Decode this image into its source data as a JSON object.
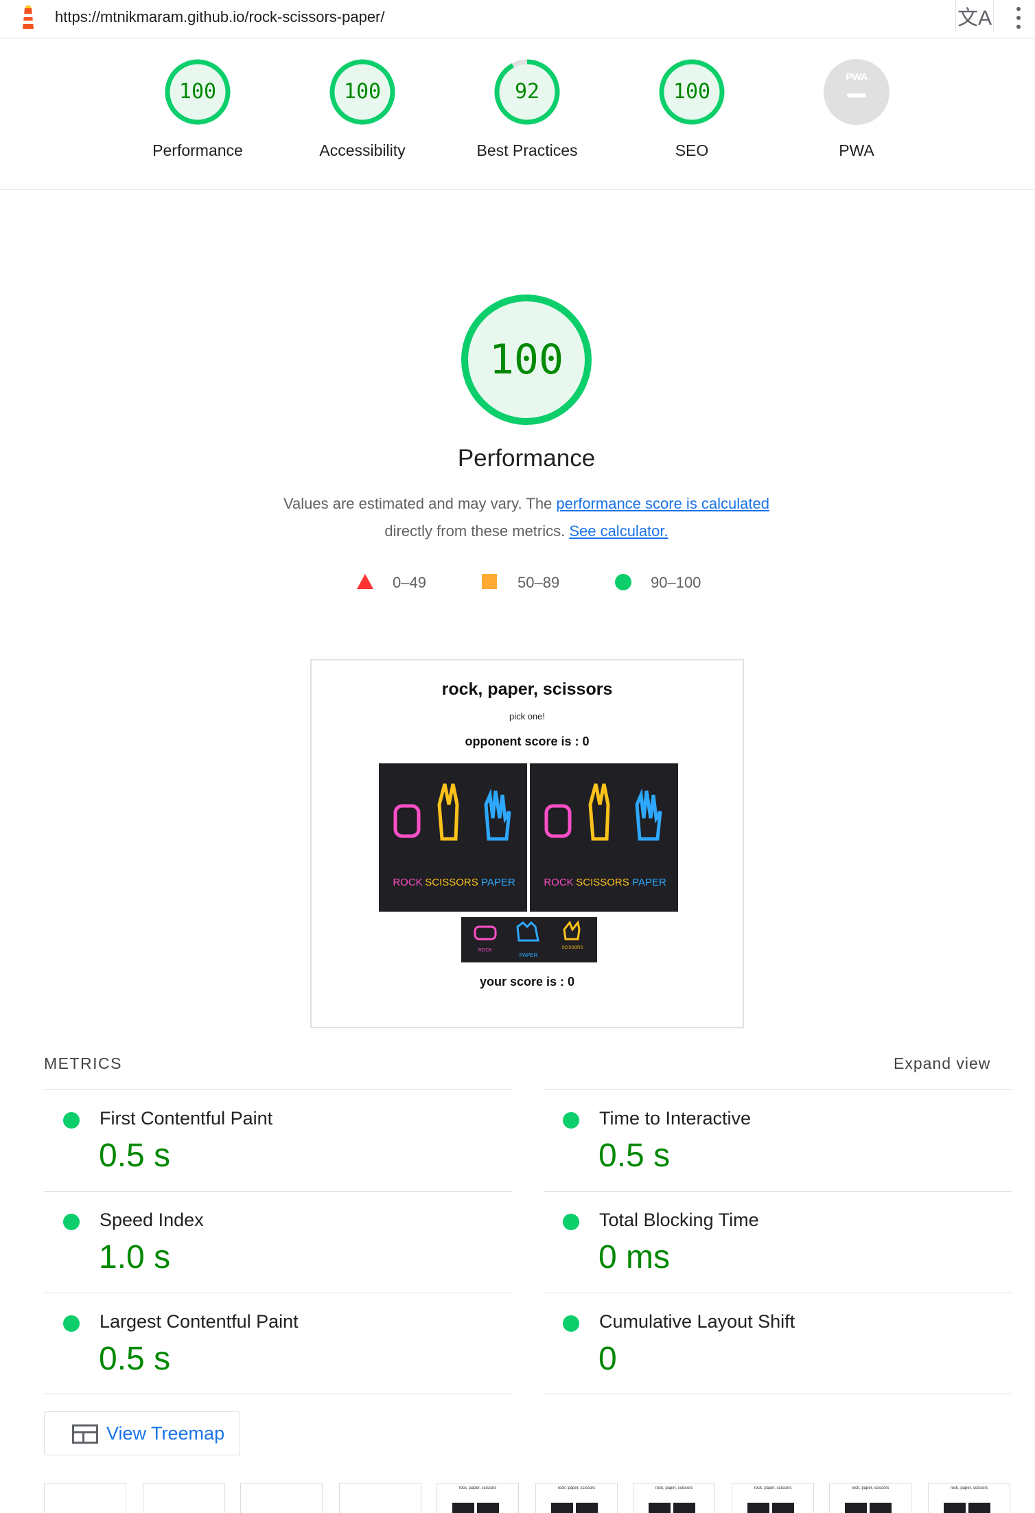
{
  "browser": {
    "url": "https://mtnikmaram.github.io/rock-scissors-paper/"
  },
  "summary": [
    {
      "score": "100",
      "label": "Performance"
    },
    {
      "score": "100",
      "label": "Accessibility"
    },
    {
      "score": "92",
      "label": "Best Practices"
    },
    {
      "score": "100",
      "label": "SEO"
    },
    {
      "score": "",
      "label": "PWA",
      "badge": "PWA"
    }
  ],
  "performance": {
    "score": "100",
    "title": "Performance",
    "desc_prefix": "Values are estimated and may vary. The ",
    "desc_link1": "performance score is calculated",
    "desc_middle": "directly from these metrics. ",
    "desc_link2": "See calculator."
  },
  "legend": [
    {
      "range": "0–49",
      "color": "#ff3333",
      "shape": "triangle"
    },
    {
      "range": "50–89",
      "color": "#ffaa33",
      "shape": "square"
    },
    {
      "range": "90–100",
      "color": "#0cce6b",
      "shape": "circle"
    }
  ],
  "screenshot": {
    "title": "rock, paper, scissors",
    "subtitle": "pick one!",
    "opponent_score": "opponent score is : 0",
    "your_score": "your score is : 0",
    "panel_labels": [
      "ROCK",
      "SCISSORS",
      "PAPER"
    ],
    "small_labels": [
      "ROCK",
      "PAPER",
      "SCISSORS"
    ]
  },
  "metrics": {
    "heading": "METRICS",
    "expand_label": "Expand view",
    "items": [
      {
        "title": "First Contentful Paint",
        "value": "0.5 s"
      },
      {
        "title": "Time to Interactive",
        "value": "0.5 s"
      },
      {
        "title": "Speed Index",
        "value": "1.0 s"
      },
      {
        "title": "Total Blocking Time",
        "value": "0 ms"
      },
      {
        "title": "Largest Contentful Paint",
        "value": "0.5 s"
      },
      {
        "title": "Cumulative Layout Shift",
        "value": "0"
      }
    ]
  },
  "treemap": {
    "label": "View Treemap"
  },
  "thumbnails": {
    "caption": "rock, paper, scissors"
  },
  "colors": {
    "pass": "#0cce6b",
    "pass_text": "#008800",
    "link": "#1a73e8",
    "pink": "#ff4fc8",
    "yellow": "#ffc21a",
    "blue": "#2ea8ff"
  }
}
